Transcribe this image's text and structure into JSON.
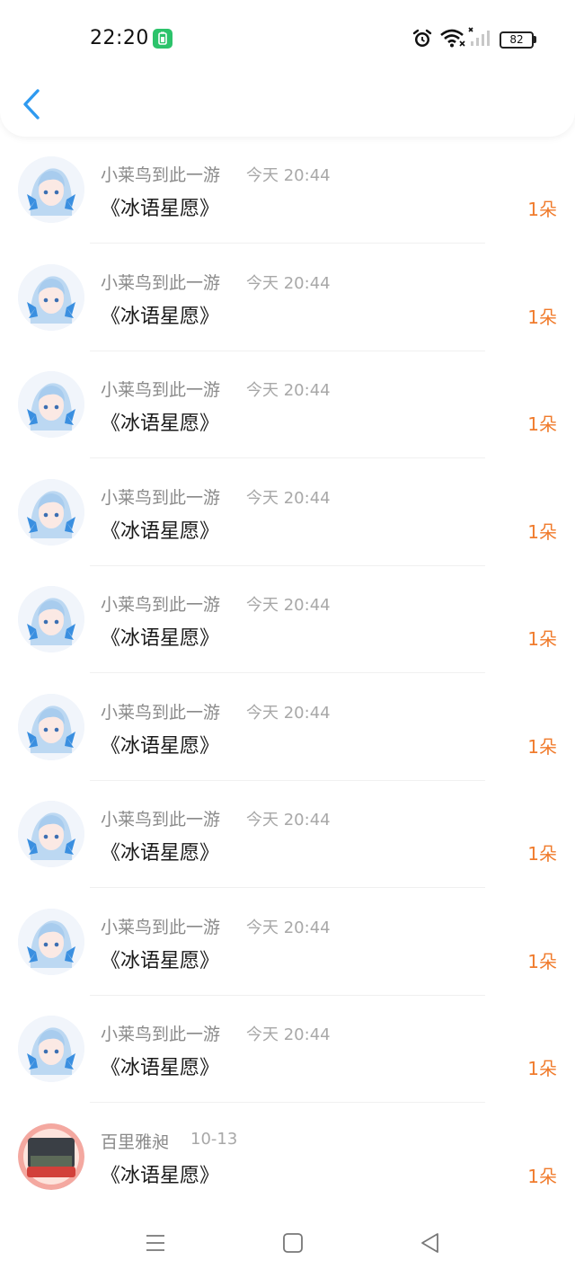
{
  "status_bar": {
    "time": "22:20",
    "battery": "82"
  },
  "colors": {
    "accent_blue": "#2e9af0",
    "amount_orange": "#f07b2c",
    "charging_green": "#2cc36b"
  },
  "icons": {
    "back": "chevron-left-icon",
    "alarm": "alarm-icon",
    "wifi": "wifi-icon",
    "signal": "signal-icon",
    "nav_menu": "menu-icon",
    "nav_home": "home-icon",
    "nav_back": "back-triangle-icon"
  },
  "records": [
    {
      "name": "小莱鸟到此一游",
      "time": "今天 20:44",
      "gift": "《冰语星愿》",
      "amount": "1朵"
    },
    {
      "name": "小莱鸟到此一游",
      "time": "今天 20:44",
      "gift": "《冰语星愿》",
      "amount": "1朵"
    },
    {
      "name": "小莱鸟到此一游",
      "time": "今天 20:44",
      "gift": "《冰语星愿》",
      "amount": "1朵"
    },
    {
      "name": "小莱鸟到此一游",
      "time": "今天 20:44",
      "gift": "《冰语星愿》",
      "amount": "1朵"
    },
    {
      "name": "小莱鸟到此一游",
      "time": "今天 20:44",
      "gift": "《冰语星愿》",
      "amount": "1朵"
    },
    {
      "name": "小莱鸟到此一游",
      "time": "今天 20:44",
      "gift": "《冰语星愿》",
      "amount": "1朵"
    },
    {
      "name": "小莱鸟到此一游",
      "time": "今天 20:44",
      "gift": "《冰语星愿》",
      "amount": "1朵"
    },
    {
      "name": "小莱鸟到此一游",
      "time": "今天 20:44",
      "gift": "《冰语星愿》",
      "amount": "1朵"
    },
    {
      "name": "小莱鸟到此一游",
      "time": "今天 20:44",
      "gift": "《冰语星愿》",
      "amount": "1朵"
    },
    {
      "name": "百里雅昶",
      "time": "10-13",
      "gift": "《冰语星愿》",
      "amount": "1朵"
    }
  ]
}
